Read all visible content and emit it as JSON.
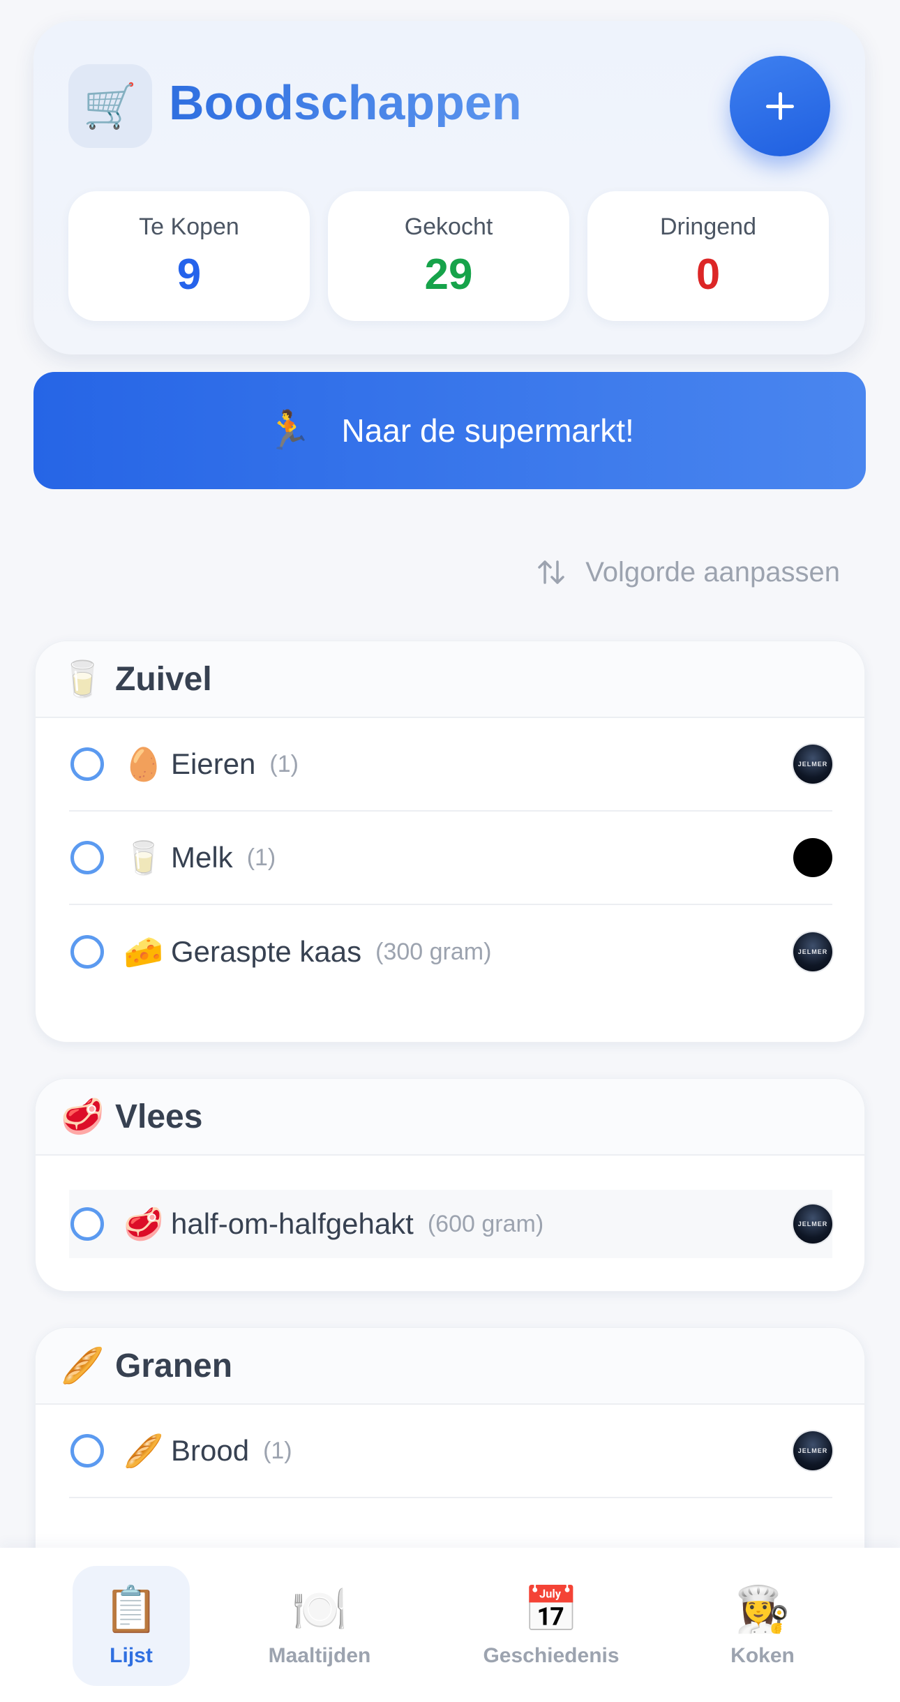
{
  "header": {
    "cart_icon": "🛒",
    "title": "Boodschappen",
    "add_button_icon": "plus-icon"
  },
  "stats": [
    {
      "label": "Te Kopen",
      "value": "9",
      "color": "#2563eb"
    },
    {
      "label": "Gekocht",
      "value": "29",
      "color": "#16a34a"
    },
    {
      "label": "Dringend",
      "value": "0",
      "color": "#dc2626"
    }
  ],
  "cta": {
    "emoji": "🏃",
    "label": "Naar de supermarkt!"
  },
  "reorder": {
    "label": "Volgorde aanpassen"
  },
  "categories": [
    {
      "emoji": "🥛",
      "title": "Zuivel",
      "items": [
        {
          "emoji": "🥚",
          "name": "Eieren",
          "qty": "(1)",
          "avatar": "JELMER"
        },
        {
          "emoji": "🥛",
          "name": "Melk",
          "qty": "(1)",
          "avatar": ""
        },
        {
          "emoji": "🧀",
          "name": "Geraspte kaas",
          "qty": "(300 gram)",
          "avatar": "JELMER"
        }
      ]
    },
    {
      "emoji": "🥩",
      "title": "Vlees",
      "items": [
        {
          "emoji": "🥩",
          "name": "half-om-halfgehakt",
          "qty": "(600 gram)",
          "avatar": "JELMER"
        }
      ]
    },
    {
      "emoji": "🥖",
      "title": "Granen",
      "items": [
        {
          "emoji": "🥖",
          "name": "Brood",
          "qty": "(1)",
          "avatar": "JELMER"
        }
      ]
    }
  ],
  "nav": [
    {
      "emoji": "📋",
      "label": "Lijst"
    },
    {
      "emoji": "🍽️",
      "label": "Maaltijden"
    },
    {
      "emoji": "📅",
      "label": "Geschiedenis"
    },
    {
      "emoji": "👩‍🍳",
      "label": "Koken"
    }
  ]
}
